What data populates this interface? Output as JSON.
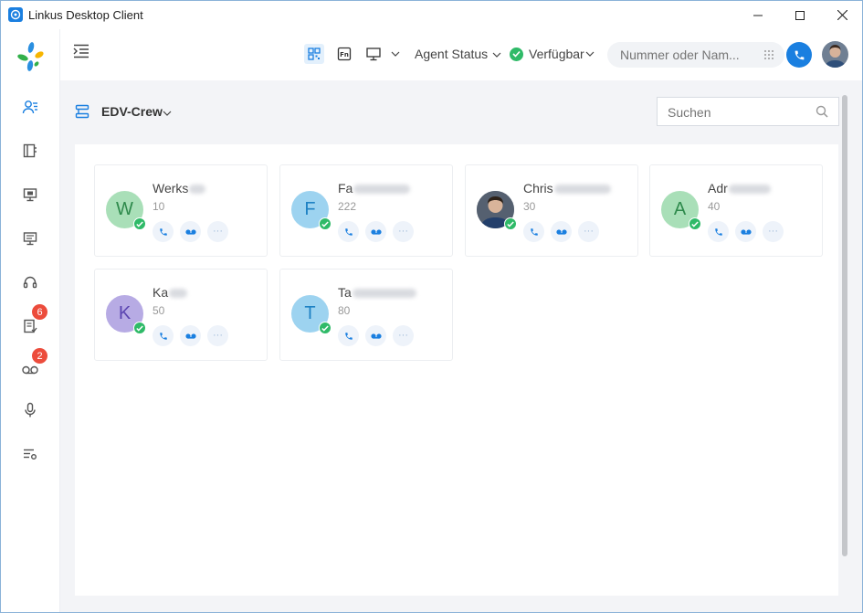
{
  "window": {
    "title": "Linkus Desktop Client"
  },
  "sidebar": {
    "items": [
      {
        "name": "contacts"
      },
      {
        "name": "phonebook"
      },
      {
        "name": "monitor"
      },
      {
        "name": "desktop"
      },
      {
        "name": "headset"
      },
      {
        "name": "call-log",
        "badge": "6"
      },
      {
        "name": "voicemail",
        "badge": "2"
      },
      {
        "name": "recordings"
      },
      {
        "name": "settings"
      }
    ]
  },
  "toolbar": {
    "agent_status_label": "Agent Status",
    "presence_label": "Verfügbar",
    "dial_placeholder": "Nummer oder Nam..."
  },
  "group": {
    "name": "EDV-Crew",
    "search_placeholder": "Suchen"
  },
  "contacts": [
    {
      "initial": "W",
      "name": "Werks",
      "ext": "10",
      "color": "#a9dfb8",
      "text_color": "#2e8a4c"
    },
    {
      "initial": "F",
      "name": "Fa",
      "ext": "222",
      "color": "#9dd3f0",
      "text_color": "#1f82c4"
    },
    {
      "initial": "",
      "name": "Chris",
      "ext": "30",
      "color": "#5a6472",
      "text_color": "#ffffff"
    },
    {
      "initial": "A",
      "name": "Adr",
      "ext": "40",
      "color": "#a9dfb8",
      "text_color": "#2e8a4c"
    },
    {
      "initial": "K",
      "name": "Ka",
      "ext": "50",
      "color": "#b7abe4",
      "text_color": "#5a44b0"
    },
    {
      "initial": "T",
      "name": "Ta",
      "ext": "80",
      "color": "#9dd3f0",
      "text_color": "#1f82c4"
    }
  ],
  "colors": {
    "accent": "#1a7fe0",
    "online": "#2fba68",
    "badge": "#ec4c3c"
  }
}
